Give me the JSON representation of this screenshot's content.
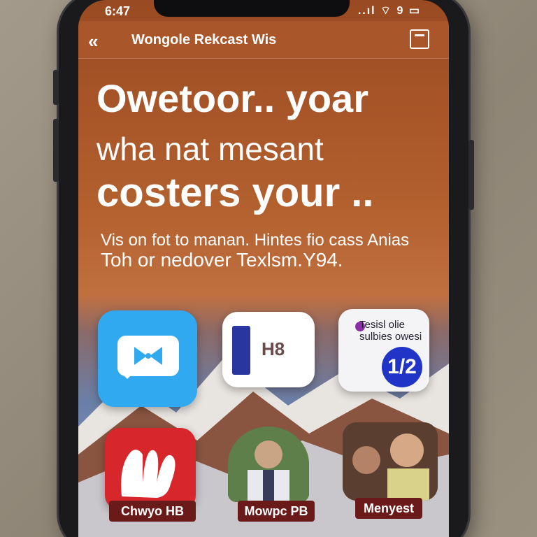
{
  "status": {
    "time": "6:47",
    "icons": "..ıl ⌔ 9 ▭"
  },
  "nav": {
    "back_icon": "chevron-double-left-icon",
    "title": "Wongole Rekcast Wis"
  },
  "headline": {
    "line1": "Owetoor.. yoar",
    "line2": "wha nat mesant",
    "line3": "costers your .."
  },
  "subtitle": {
    "line1": "Vis on fot to manan. Hintes fio cass Anias",
    "line2": "Toh or nedover Texlsm.Y94."
  },
  "apps": {
    "chat_text": "H8",
    "card_text": "Tesisl olie sulbies owesi",
    "card_badge": "1/2",
    "label_1": "Chwyo HB",
    "label_2": "Mowpc PB",
    "label_3": "Menyest"
  },
  "colors": {
    "screen_top": "#9a4a22",
    "nav_bar": "#a9562b",
    "app_blue": "#30a9f0",
    "app_red": "#d7262c",
    "badge_blue": "#2034c8",
    "label_pill": "#6b1a1a"
  }
}
